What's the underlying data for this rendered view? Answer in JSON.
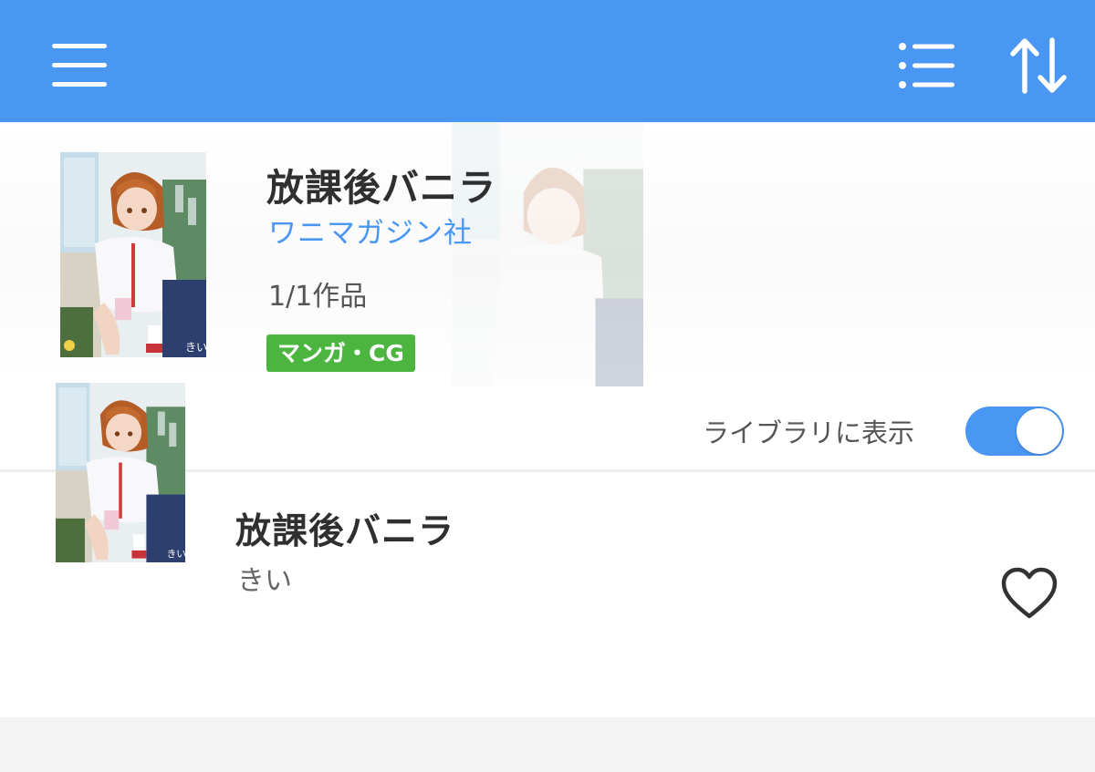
{
  "toolbar": {
    "menu_icon": "hamburger-menu-icon",
    "list_icon": "list-view-icon",
    "sort_icon": "sort-arrows-icon"
  },
  "series": {
    "title": "放課後バニラ",
    "publisher": "ワニマガジン社",
    "count": "1/1作品",
    "category": "マンガ・CG",
    "library_label": "ライブラリに表示",
    "library_toggle_on": true
  },
  "books": [
    {
      "title": "放課後バニラ",
      "author": "きい",
      "favorite_icon": "heart-outline-icon"
    }
  ],
  "colors": {
    "accent": "#4a97f3",
    "badge": "#4cb540",
    "text": "#2f2f2f",
    "subtext": "#555555",
    "background": "#f3f3f3"
  }
}
